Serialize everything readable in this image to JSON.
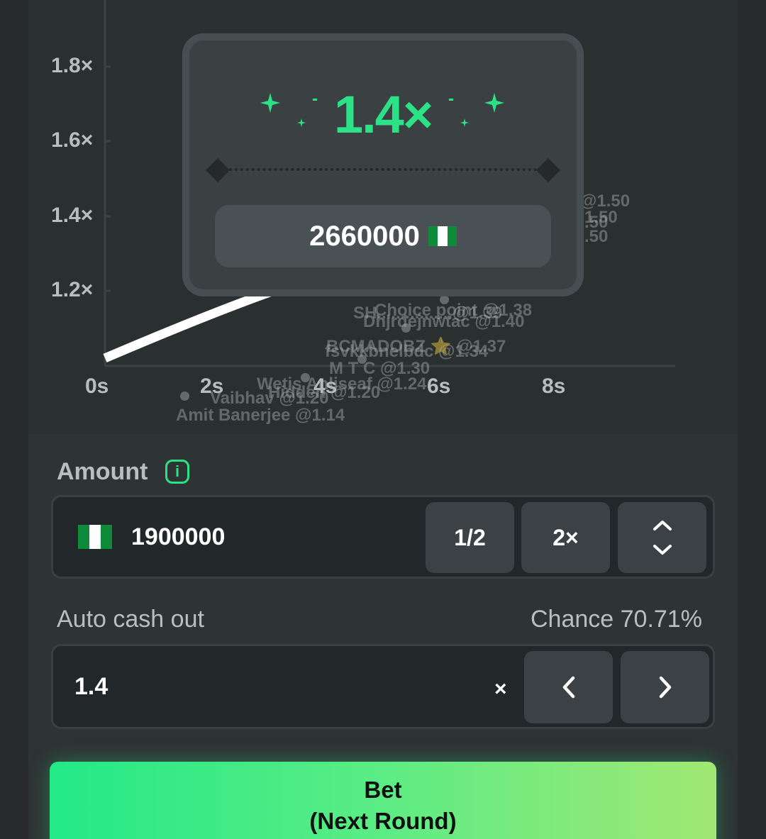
{
  "graph": {
    "y_ticks": [
      "1.8×",
      "1.6×",
      "1.4×",
      "1.2×"
    ],
    "x_ticks": [
      "0s",
      "2s",
      "4s",
      "6s",
      "8s"
    ],
    "players": [
      {
        "label": "@1.50"
      },
      {
        "label": "1.50"
      },
      {
        "label": ".50"
      },
      {
        "label": ".50"
      },
      {
        "label": "Choice point @1.38"
      },
      {
        "label": "SH................@1.39"
      },
      {
        "label": "Dhjrdejnwtac @1.40"
      },
      {
        "label": "BCMADOBZ ⭐ @1.37"
      },
      {
        "label": "fsvkkbnelbdc @1.34"
      },
      {
        "label": "M T C @1.30"
      },
      {
        "label": "Wetis Anliseaf @1.24"
      },
      {
        "label": "Hidden @1.20"
      },
      {
        "label": "Vaibhav @1.20"
      },
      {
        "label": "Amit Banerjee @1.14"
      }
    ]
  },
  "result_popup": {
    "multiplier": "1.4×",
    "win_amount": "2660000",
    "currency_flag": "nigeria-flag"
  },
  "bet_form": {
    "amount_label": "Amount",
    "amount_value": "1900000",
    "half_label": "1/2",
    "double_label": "2×",
    "auto_cash_out_label": "Auto cash out",
    "chance_text": "Chance 70.71%",
    "auto_cash_out_value": "1.4",
    "clear_symbol": "×",
    "bet_button_line1": "Bet",
    "bet_button_line2": "(Next Round)"
  },
  "colors": {
    "accent": "#2be286",
    "background": "#2e3334",
    "flag_green": "#0d8a3a",
    "flag_white": "#ffffff"
  }
}
